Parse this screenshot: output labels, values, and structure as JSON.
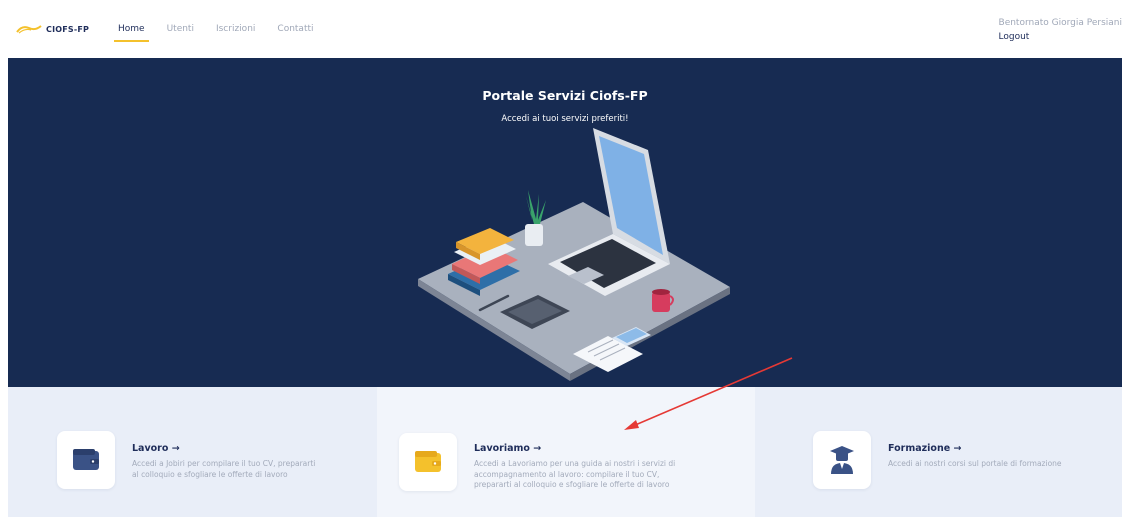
{
  "brand": {
    "name": "CIOFS-FP"
  },
  "nav": {
    "links": [
      {
        "label": "Home"
      },
      {
        "label": "Utenti"
      },
      {
        "label": "Iscrizioni"
      },
      {
        "label": "Contatti"
      }
    ],
    "active_index": 0
  },
  "user": {
    "greeting": "Bentornato Giorgia Persiani",
    "logout_label": "Logout"
  },
  "hero": {
    "title": "Portale Servizi Ciofs-FP",
    "subtitle": "Accedi ai tuoi servizi preferiti!"
  },
  "cards": [
    {
      "title": "Lavoro →",
      "description": "Accedi a Jobiri per compilare il tuo CV, prepararti al colloquio e sfogliare le offerte di lavoro",
      "icon": "wallet-icon",
      "icon_color": "#3a5286"
    },
    {
      "title": "Lavoriamo →",
      "description": "Accedi a Lavoriamo per una guida ai nostri i servizi di accompagnamento al lavoro: compilare il tuo CV, prepararti al colloquio e sfogliare le offerte di lavoro",
      "icon": "wallet-icon",
      "icon_color": "#f4c12c"
    },
    {
      "title": "Formazione →",
      "description": "Accedi ai nostri corsi sul portale di formazione",
      "icon": "graduate-icon",
      "icon_color": "#3a5286"
    }
  ],
  "colors": {
    "hero_bg": "#172b52",
    "accent_yellow": "#f4c12c",
    "annotation_arrow": "#e53935"
  }
}
